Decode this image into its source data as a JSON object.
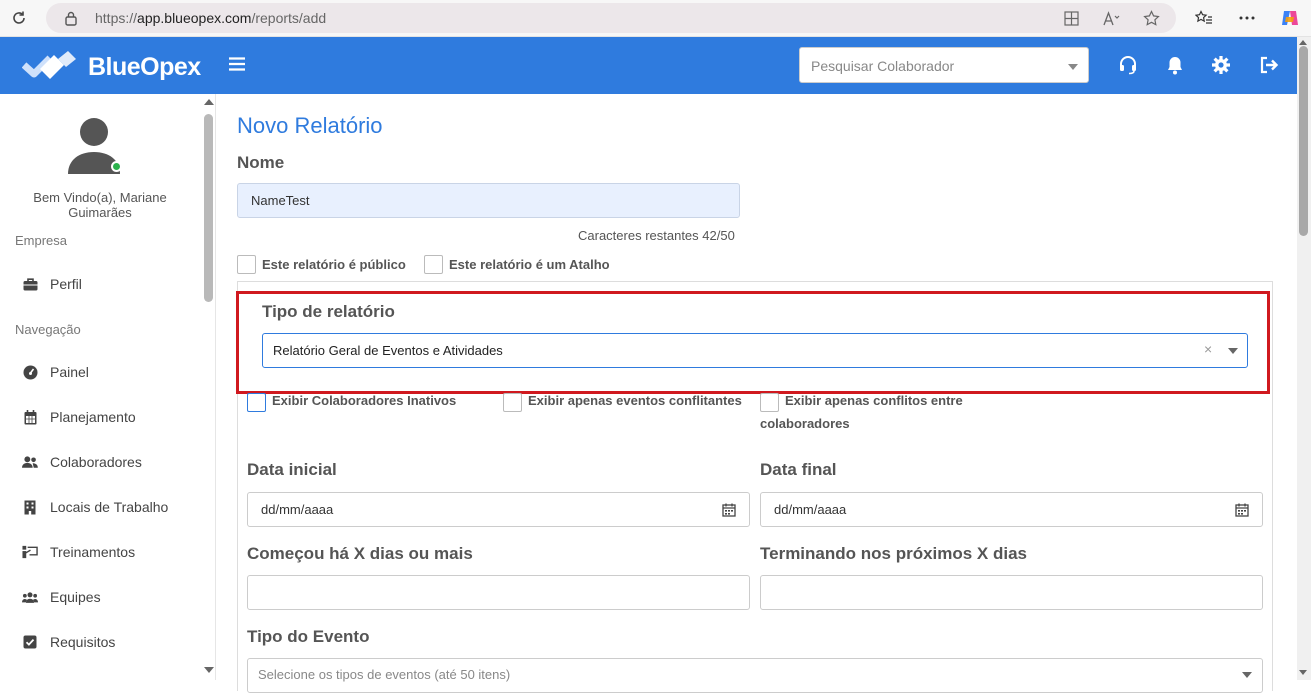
{
  "browser": {
    "url_prefix": "https://",
    "url_host": "app.blueopex.com",
    "url_path": "/reports/add"
  },
  "header": {
    "brand": "BlueOpex",
    "search_placeholder": "Pesquisar Colaborador"
  },
  "sidebar": {
    "welcome": "Bem Vindo(a), Mariane Guimarães",
    "section_company": "Empresa",
    "section_nav": "Navegação",
    "items": [
      {
        "label": "Perfil",
        "icon": "briefcase-icon"
      },
      {
        "label": "Painel",
        "icon": "dashboard-icon"
      },
      {
        "label": "Planejamento",
        "icon": "calendar-icon"
      },
      {
        "label": "Colaboradores",
        "icon": "users-icon"
      },
      {
        "label": "Locais de Trabalho",
        "icon": "building-icon"
      },
      {
        "label": "Treinamentos",
        "icon": "training-icon"
      },
      {
        "label": "Equipes",
        "icon": "team-icon"
      },
      {
        "label": "Requisitos",
        "icon": "checkbox-icon"
      }
    ]
  },
  "form": {
    "title": "Novo Relatório",
    "name_label": "Nome",
    "name_value": "NameTest",
    "chars_remaining": "Caracteres restantes 42/50",
    "public_label": "Este relatório é público",
    "shortcut_label": "Este relatório é um Atalho",
    "type_label": "Tipo de relatório",
    "type_value": "Relatório Geral de Eventos e Atividades",
    "clear_symbol": "×",
    "opt_inactive": "Exibir Colaboradores Inativos",
    "opt_conflicts": "Exibir apenas eventos conflitantes",
    "opt_between_line1": "Exibir apenas conflitos entre",
    "opt_between_line2": "colaboradores",
    "start_date_label": "Data inicial",
    "end_date_label": "Data final",
    "date_placeholder": "dd/mm/aaaa",
    "started_days_label": "Começou há X dias ou mais",
    "ending_days_label": "Terminando nos próximos X dias",
    "event_type_label": "Tipo do Evento",
    "event_type_placeholder": "Selecione os tipos de eventos (até 50 itens)"
  },
  "colors": {
    "brand_blue": "#2f7bde",
    "highlight_red": "#d0191f"
  }
}
